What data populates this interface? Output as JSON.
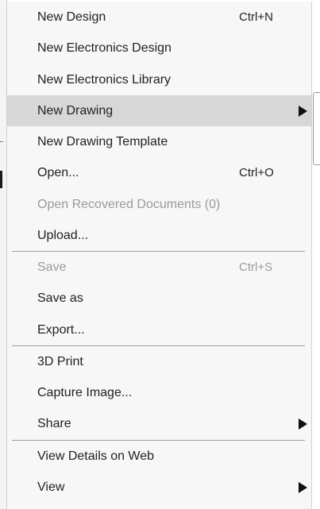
{
  "menu": {
    "groups": [
      {
        "items": [
          {
            "label": "New Design",
            "shortcut": "Ctrl+N"
          },
          {
            "label": "New Electronics Design"
          },
          {
            "label": "New Electronics Library"
          },
          {
            "label": "New Drawing",
            "state": "highlighted",
            "has_submenu": true
          },
          {
            "label": "New Drawing Template"
          },
          {
            "label": "Open...",
            "shortcut": "Ctrl+O"
          },
          {
            "label": "Open Recovered Documents (0)",
            "state": "disabled"
          },
          {
            "label": "Upload..."
          }
        ]
      },
      {
        "items": [
          {
            "label": "Save",
            "shortcut": "Ctrl+S",
            "state": "disabled"
          },
          {
            "label": "Save as"
          },
          {
            "label": "Export..."
          }
        ]
      },
      {
        "items": [
          {
            "label": "3D Print"
          },
          {
            "label": "Capture Image..."
          },
          {
            "label": "Share",
            "has_submenu": true
          }
        ]
      },
      {
        "items": [
          {
            "label": "View Details on Web"
          },
          {
            "label": "View",
            "has_submenu": true
          }
        ]
      }
    ]
  },
  "colors": {
    "menu_background": "#f7f7f7",
    "highlight_background": "#d7d7d7",
    "text": "#222222",
    "disabled_text": "#9a9a9a",
    "separator": "#9e9e9e"
  }
}
